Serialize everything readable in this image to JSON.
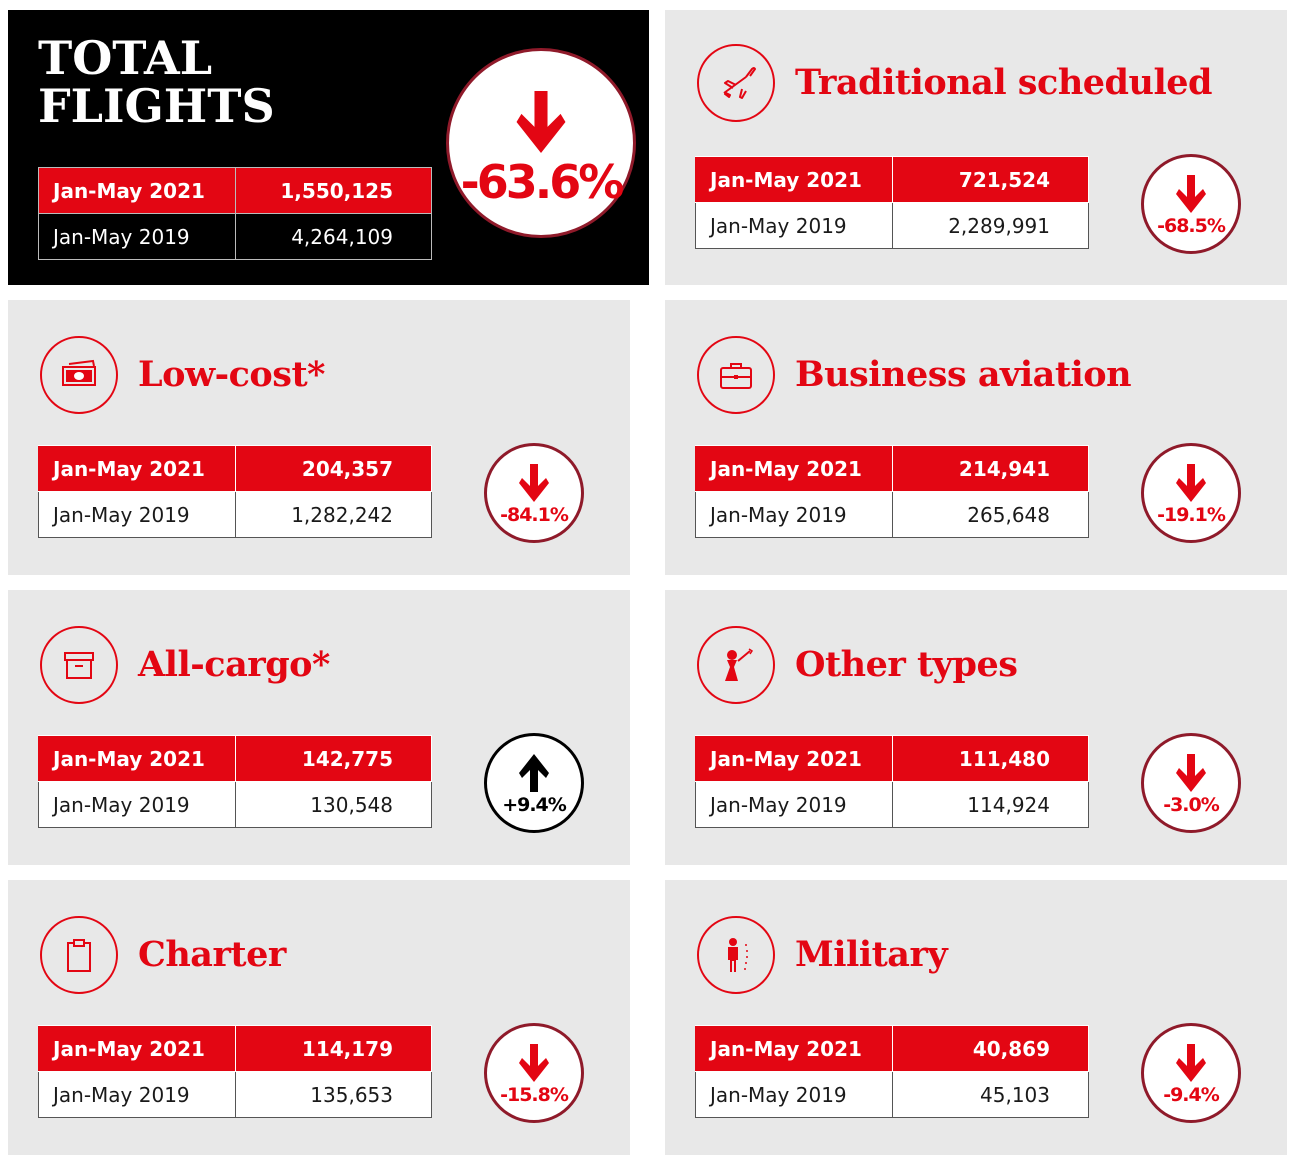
{
  "total": {
    "title_line1": "TOTAL",
    "title_line2": "FLIGHTS",
    "current_label": "Jan-May 2021",
    "current_value": "1,550,125",
    "previous_label": "Jan-May 2019",
    "previous_value": "4,264,109",
    "change": "-63.6%",
    "direction": "down"
  },
  "categories": [
    {
      "title": "Traditional scheduled",
      "icon": "airplane-icon",
      "current_label": "Jan-May 2021",
      "current_value": "721,524",
      "previous_label": "Jan-May 2019",
      "previous_value": "2,289,991",
      "change": "-68.5%",
      "direction": "down"
    },
    {
      "title": "Low-cost*",
      "icon": "banknote-icon",
      "current_label": "Jan-May 2021",
      "current_value": "204,357",
      "previous_label": "Jan-May 2019",
      "previous_value": "1,282,242",
      "change": "-84.1%",
      "direction": "down"
    },
    {
      "title": "Business aviation",
      "icon": "briefcase-icon",
      "current_label": "Jan-May 2021",
      "current_value": "214,941",
      "previous_label": "Jan-May 2019",
      "previous_value": "265,648",
      "change": "-19.1%",
      "direction": "down"
    },
    {
      "title": "All-cargo*",
      "icon": "box-icon",
      "current_label": "Jan-May 2021",
      "current_value": "142,775",
      "previous_label": "Jan-May 2019",
      "previous_value": "130,548",
      "change": "+9.4%",
      "direction": "up"
    },
    {
      "title": "Other types",
      "icon": "hot-air-balloon-icon",
      "current_label": "Jan-May 2021",
      "current_value": "111,480",
      "previous_label": "Jan-May 2019",
      "previous_value": "114,924",
      "change": "-3.0%",
      "direction": "down"
    },
    {
      "title": "Charter",
      "icon": "clipboard-icon",
      "current_label": "Jan-May 2021",
      "current_value": "114,179",
      "previous_label": "Jan-May 2019",
      "previous_value": "135,653",
      "change": "-15.8%",
      "direction": "down"
    },
    {
      "title": "Military",
      "icon": "soldier-icon",
      "current_label": "Jan-May 2021",
      "current_value": "40,869",
      "previous_label": "Jan-May 2019",
      "previous_value": "45,103",
      "change": "-9.4%",
      "direction": "down"
    }
  ],
  "colors": {
    "accent": "#e30613",
    "panel": "#e8e8e8",
    "badge_border": "#8f1a2a"
  }
}
